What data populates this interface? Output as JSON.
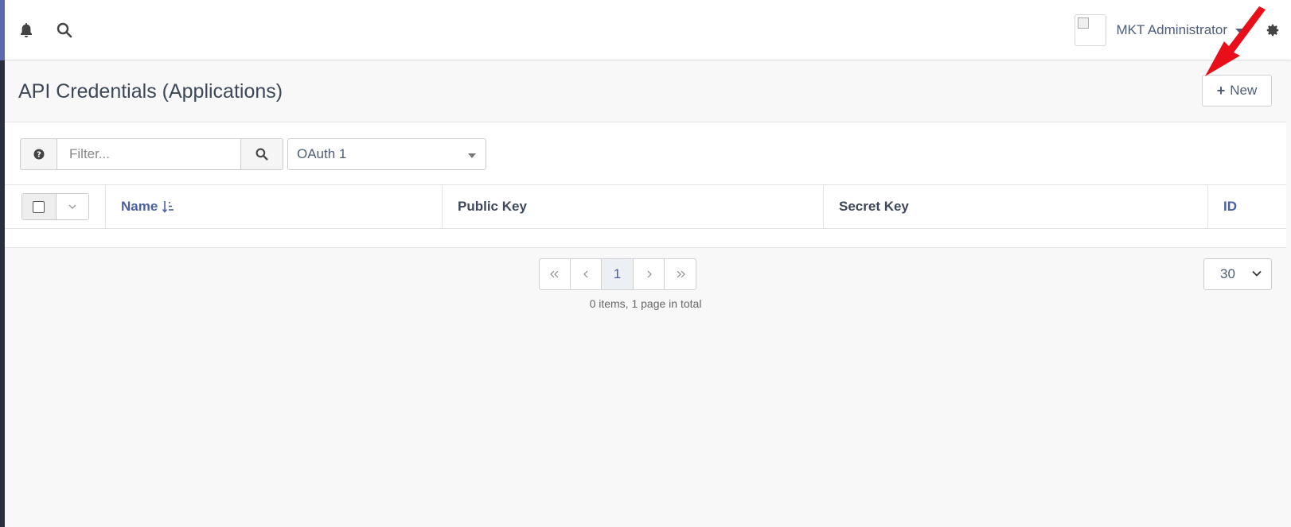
{
  "colors": {
    "accent": "#4a5fa8",
    "arrow": "#e80f1a",
    "rail": "#2a2f3d"
  },
  "topbar": {
    "bell_icon": "bell-icon",
    "search_icon": "search-icon",
    "user_name": "MKT Administrator",
    "settings_icon": "gear-icon"
  },
  "header": {
    "title": "API Credentials (Applications)",
    "new_label": "New"
  },
  "filter": {
    "placeholder": "Filter...",
    "type_selected": "OAuth 1"
  },
  "table": {
    "columns": {
      "name": "Name",
      "public_key": "Public Key",
      "secret_key": "Secret Key",
      "id": "ID"
    },
    "rows": []
  },
  "pagination": {
    "current": "1",
    "summary": "0 items, 1 page in total",
    "per_page": "30"
  }
}
